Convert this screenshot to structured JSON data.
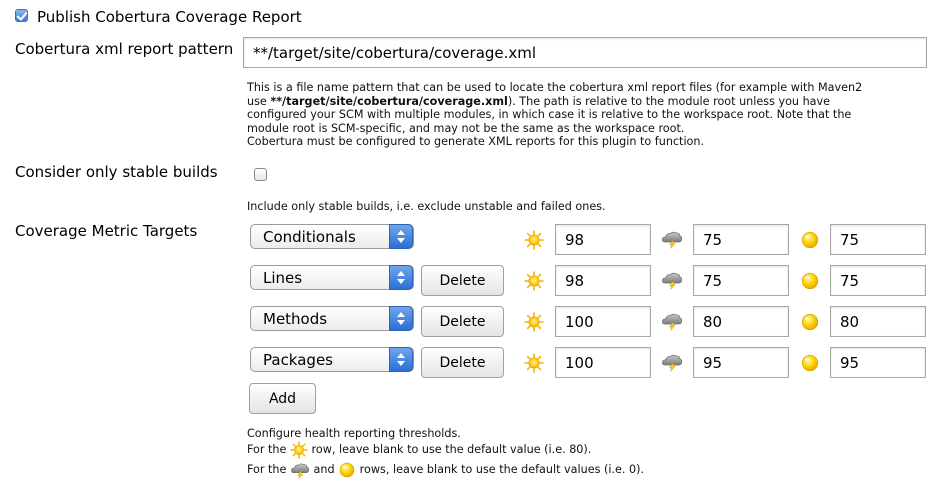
{
  "publish": {
    "label": "Publish Cobertura Coverage Report",
    "checked": true
  },
  "report_pattern": {
    "label": "Cobertura xml report pattern",
    "value": "**/target/site/cobertura/coverage.xml",
    "help_line1": "This is a file name pattern that can be used to locate the cobertura xml report files (for example with Maven2",
    "help_line2_pre": "use ",
    "help_line2_bold": "**/target/site/cobertura/coverage.xml",
    "help_line2_post": "). The path is relative to the module root unless you have",
    "help_line3": "configured your SCM with multiple modules, in which case it is relative to the workspace root. Note that the",
    "help_line4": "module root is SCM-specific, and may not be the same as the workspace root.",
    "help_line5": "Cobertura must be configured to generate XML reports for this plugin to function."
  },
  "stable_builds": {
    "label": "Consider only stable builds",
    "checked": false,
    "help": "Include only stable builds, i.e. exclude unstable and failed ones."
  },
  "targets": {
    "label": "Coverage Metric Targets",
    "delete_label": "Delete",
    "add_label": "Add",
    "rows": [
      {
        "metric": "Conditionals",
        "sunny": "98",
        "stormy": "75",
        "unstable": "75",
        "has_delete": false
      },
      {
        "metric": "Lines",
        "sunny": "98",
        "stormy": "75",
        "unstable": "75",
        "has_delete": true
      },
      {
        "metric": "Methods",
        "sunny": "100",
        "stormy": "80",
        "unstable": "80",
        "has_delete": true
      },
      {
        "metric": "Packages",
        "sunny": "100",
        "stormy": "95",
        "unstable": "95",
        "has_delete": true
      }
    ],
    "help_line1": "Configure health reporting thresholds.",
    "help_line2_pre": "For the ",
    "help_line2_post": " row, leave blank to use the default value (i.e. 80).",
    "help_line3_pre": "For the ",
    "help_line3_mid": " and ",
    "help_line3_post": " rows, leave blank to use the default values (i.e. 0)."
  },
  "icons": {
    "sunny": "sunny-weather-icon",
    "stormy": "stormy-weather-icon",
    "unstable": "unstable-ball-icon"
  }
}
